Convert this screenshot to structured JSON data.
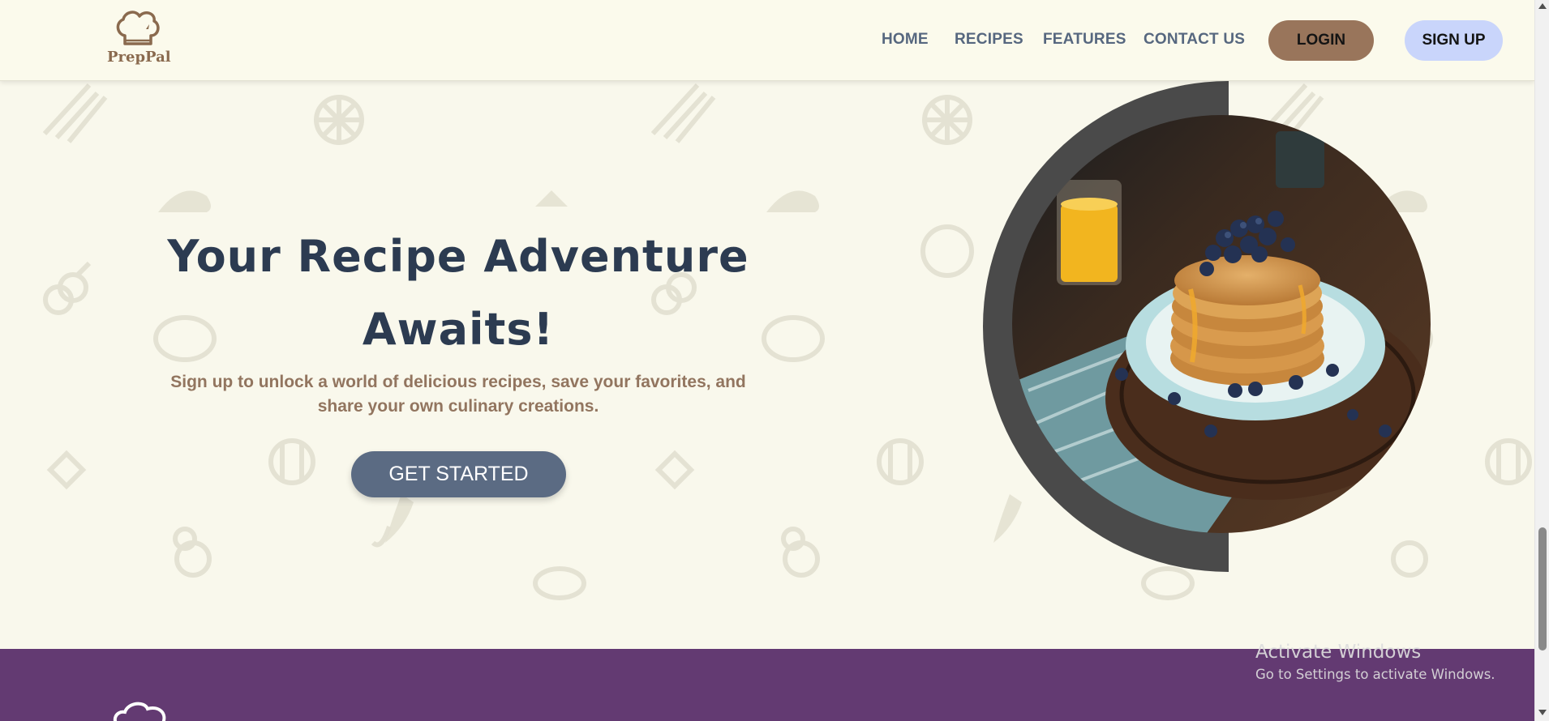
{
  "brand": {
    "name": "PrepPal",
    "logo_icon": "chef-hat-icon"
  },
  "nav": {
    "links": [
      "HOME",
      "RECIPES",
      "FEATURES",
      "CONTACT US"
    ],
    "login_label": "LOGIN",
    "signup_label": "SIGN UP"
  },
  "hero": {
    "title": "Your Recipe Adventure Awaits!",
    "subtitle": "Sign up to unlock a world of delicious recipes, save your favorites, and share your own culinary creations.",
    "cta_label": "GET STARTED",
    "image_icon": "pancakes-photo"
  },
  "watermark": {
    "title": "Activate Windows",
    "subtitle": "Go to Settings to activate Windows."
  },
  "colors": {
    "background": "#f9f8ec",
    "nav_text": "#56677f",
    "title": "#2c3b51",
    "subtitle": "#92755f",
    "login_bg": "#99755b",
    "signup_bg": "#c9d5fb",
    "cta_bg": "#5b6b83",
    "footer_bg": "#633a72",
    "disc": "#4a4a4a"
  }
}
